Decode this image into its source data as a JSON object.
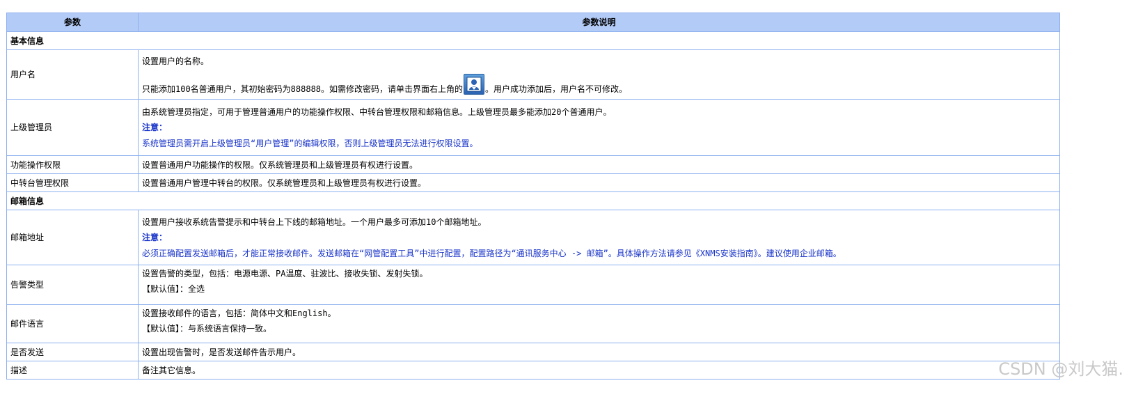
{
  "header": {
    "col1": "参数",
    "col2": "参数说明"
  },
  "sections": {
    "basic": "基本信息",
    "mailbox": "邮箱信息"
  },
  "rows": {
    "username": {
      "name": "用户名",
      "line1": "设置用户的名称。",
      "line2a": "只能添加100名普通用户，其初始密码为888888。如需修改密码，请单击界面右上角的",
      "line2b": "。用户成功添加后，用户名不可修改。"
    },
    "supervisor": {
      "name": "上级管理员",
      "line1": "由系统管理员指定，可用于管理普通用户的功能操作权限、中转台管理权限和邮箱信息。上级管理员最多能添加20个普通用户。",
      "note_title": "注意：",
      "note_text": "系统管理员需开启上级管理员“用户管理”的编辑权限，否则上级管理员无法进行权限设置。"
    },
    "func_perm": {
      "name": "功能操作权限",
      "line1": "设置普通用户功能操作的权限。仅系统管理员和上级管理员有权进行设置。"
    },
    "relay_perm": {
      "name": "中转台管理权限",
      "line1": "设置普通用户管理中转台的权限。仅系统管理员和上级管理员有权进行设置。"
    },
    "email_addr": {
      "name": "邮箱地址",
      "line1": "设置用户接收系统告警提示和中转台上下线的邮箱地址。一个用户最多可添加10个邮箱地址。",
      "note_title": "注意：",
      "note_text": "必须正确配置发送邮箱后，才能正常接收邮件。发送邮箱在“网管配置工具”中进行配置，配置路径为“通讯服务中心 -> 邮箱”。具体操作方法请参见《XNMS安装指南》。建议使用企业邮箱。"
    },
    "alarm_type": {
      "name": "告警类型",
      "line1": "设置告警的类型，包括：电源电源、PA温度、驻波比、接收失锁、发射失锁。",
      "line2": "【默认值】：全选"
    },
    "mail_lang": {
      "name": "邮件语言",
      "line1": "设置接收邮件的语言，包括：简体中文和English。",
      "line2": "【默认值】：与系统语言保持一致。"
    },
    "send": {
      "name": "是否发送",
      "line1": "设置出现告警时，是否发送邮件告示用户。"
    },
    "desc": {
      "name": "描述",
      "line1": "备注其它信息。"
    }
  },
  "icons": {
    "user_settings": "user-account-icon"
  },
  "colors": {
    "header_bg": "#b3cbf7",
    "border": "#8cb0ee",
    "note": "#1a35c9"
  },
  "watermark": "CSDN @刘大猫."
}
